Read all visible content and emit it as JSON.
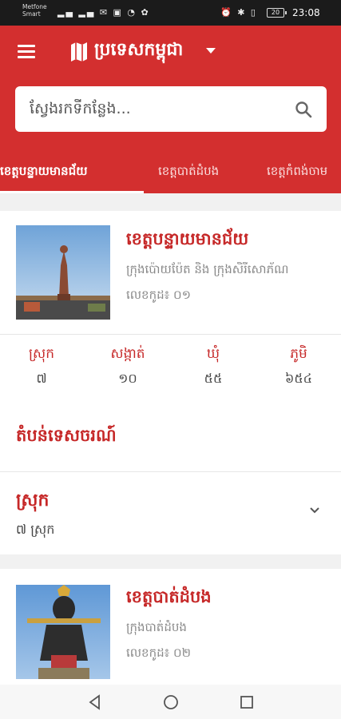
{
  "status_bar": {
    "carrier_line1": "Metfone",
    "carrier_line2": "Smart",
    "left_icons": "▂▄ ▂▄ ✉ ▣ ◔ ✿",
    "right_icons": "⏰ ✱ ▯",
    "battery": "20",
    "time": "23:08"
  },
  "header": {
    "title": "ប្រទេសកម្ពុជា",
    "search_placeholder": "ស្វែងរកទីកន្លែង..."
  },
  "tabs": [
    "ខេត្តបន្ទាយមានជ័យ",
    "ខេត្តបាត់ដំបង",
    "ខេត្តកំពង់ចាម"
  ],
  "province1": {
    "name": "ខេត្តបន្ទាយមានជ័យ",
    "cities": "ក្រុងប៉ោយប៉ែត និង ក្រុងសិរីសោភ័ណ",
    "code": "លេខកូដ៖ ០១",
    "stats": [
      {
        "label": "ស្រុក",
        "value": "៧"
      },
      {
        "label": "សង្កាត់",
        "value": "១០"
      },
      {
        "label": "ឃុំ",
        "value": "៥៥"
      },
      {
        "label": "ភូមិ",
        "value": "៦៥៤"
      }
    ],
    "section_title": "តំបន់ទេសចរណ៍",
    "accordion_title": "ស្រុក",
    "accordion_sub": "៧ ស្រុក"
  },
  "province2": {
    "name": "ខេត្តបាត់ដំបង",
    "cities": "ក្រុងបាត់ដំបង",
    "code": "លេខកូដ៖ ០២"
  },
  "colors": {
    "primary": "#d32f2f",
    "accent_text": "#c62828"
  }
}
